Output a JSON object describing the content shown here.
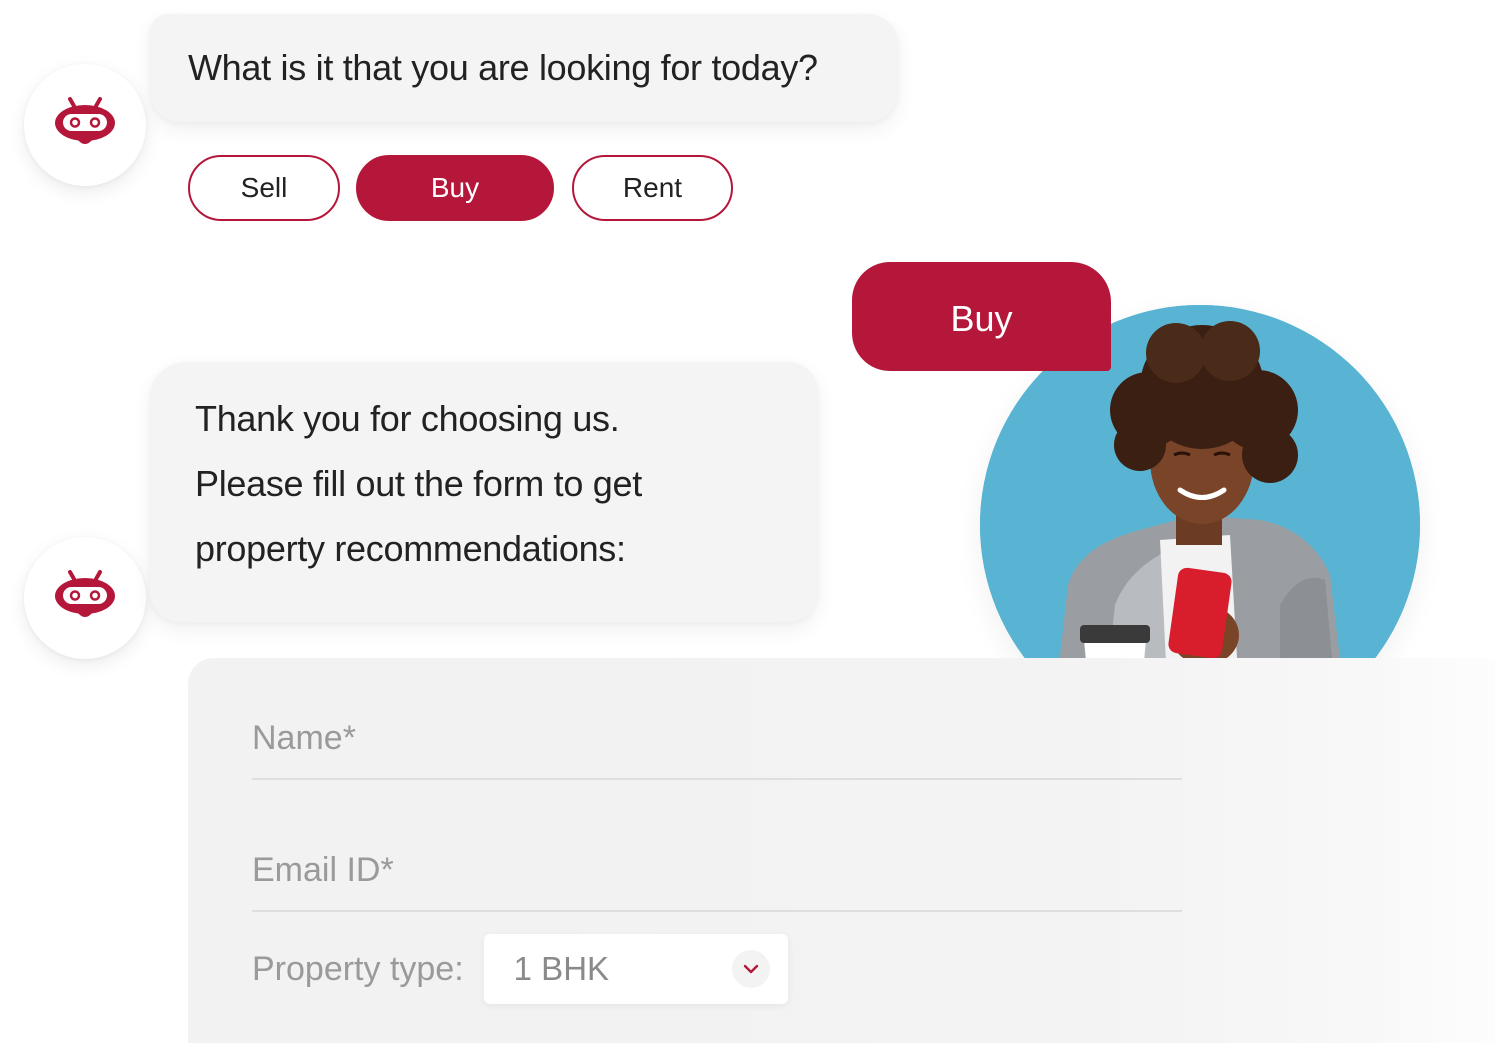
{
  "colors": {
    "accent": "#b5173b",
    "bubble_bg": "#f4f4f4",
    "photo_bg": "#59b4d3"
  },
  "bot": {
    "avatar_icon": "robot-icon",
    "question": "What is it that you are looking for today?",
    "reply_lines": [
      "Thank you for choosing us.",
      "Please fill out the form to get",
      "property recommendations:"
    ]
  },
  "options": [
    {
      "label": "Sell",
      "selected": false
    },
    {
      "label": "Buy",
      "selected": true
    },
    {
      "label": "Rent",
      "selected": false
    }
  ],
  "user": {
    "reply": "Buy"
  },
  "form": {
    "name_placeholder": "Name*",
    "email_placeholder": "Email ID*",
    "property_label": "Property type:",
    "property_value": "1 BHK",
    "dropdown_icon": "chevron-down-icon"
  }
}
